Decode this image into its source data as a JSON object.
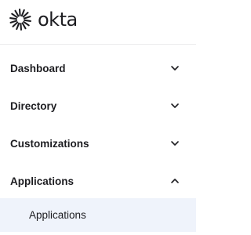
{
  "brand": {
    "name": "okta",
    "logo_icon": "okta-sunburst-icon"
  },
  "nav": {
    "items": [
      {
        "label": "Dashboard",
        "expanded": false,
        "icon": "chevron-down-icon"
      },
      {
        "label": "Directory",
        "expanded": false,
        "icon": "chevron-down-icon"
      },
      {
        "label": "Customizations",
        "expanded": false,
        "icon": "chevron-down-icon"
      },
      {
        "label": "Applications",
        "expanded": true,
        "icon": "chevron-up-icon"
      }
    ],
    "subitems": [
      {
        "label": "Applications",
        "selected": true
      }
    ]
  },
  "colors": {
    "text": "#1d1d21",
    "selected_bg": "#eff3fb",
    "divider": "#ebebed"
  }
}
